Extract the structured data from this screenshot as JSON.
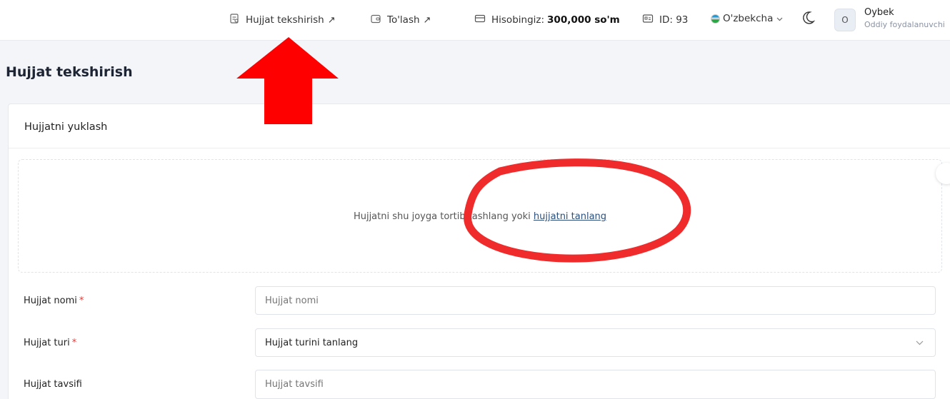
{
  "header": {
    "nav_check": "Hujjat tekshirish",
    "nav_check_arrow": "↗",
    "nav_pay": "To'lash",
    "nav_pay_arrow": "↗",
    "balance_label": "Hisobingiz:",
    "balance_value": "300,000 so'm",
    "id_text": "ID: 93",
    "language": "O'zbekcha",
    "user_initial": "O",
    "user_name": "Oybek",
    "user_role": "Oddiy foydalanuvchi"
  },
  "page": {
    "title": "Hujjat tekshirish"
  },
  "upload": {
    "card_title": "Hujjatni yuklash",
    "drop_text": "Hujjatni shu joyga tortib tashlang yoki",
    "drop_link": "hujjatni tanlang"
  },
  "form": {
    "name_label": "Hujjat nomi",
    "name_placeholder": "Hujjat nomi",
    "type_label": "Hujjat turi",
    "type_value": "Hujjat turini tanlang",
    "desc_label": "Hujjat tavsifi",
    "desc_placeholder": "Hujjat tavsifi",
    "required_mark": "*"
  },
  "colors": {
    "annotation_red": "#ff0000",
    "link": "#2c4f7c"
  },
  "icons": [
    "document-check-icon",
    "wallet-icon",
    "card-icon",
    "id-card-icon",
    "flag-icon",
    "moon-icon",
    "chevron-down-icon"
  ]
}
